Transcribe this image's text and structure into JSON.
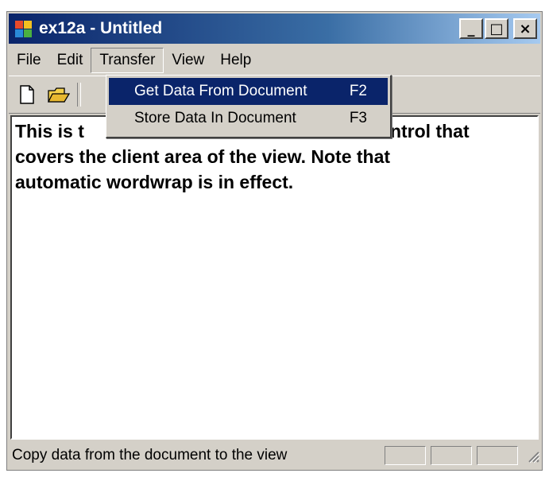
{
  "window": {
    "title": "ex12a - Untitled",
    "minimize_glyph": "_",
    "maximize_glyph": "□",
    "close_glyph": "×"
  },
  "menu": {
    "file": "File",
    "edit": "Edit",
    "transfer": "Transfer",
    "view": "View",
    "help": "Help"
  },
  "transfer_menu": {
    "items": [
      {
        "label": "Get Data From Document",
        "shortcut": "F2"
      },
      {
        "label": "Store Data In Document",
        "shortcut": "F3"
      }
    ]
  },
  "toolbar": {
    "icons": [
      "new-document-icon",
      "open-folder-icon"
    ]
  },
  "editor": {
    "text_line_1": "This is t",
    "text_line_1_end": "ontrol that",
    "text_line_2": "covers the client area of the view.  Note that",
    "text_line_3": "automatic wordwrap is in effect."
  },
  "status": {
    "text": "Copy data from the document to the view"
  },
  "colors": {
    "title_start": "#0a246a",
    "title_end": "#a6caf0",
    "face": "#d4d0c8",
    "highlight": "#0a246a"
  }
}
